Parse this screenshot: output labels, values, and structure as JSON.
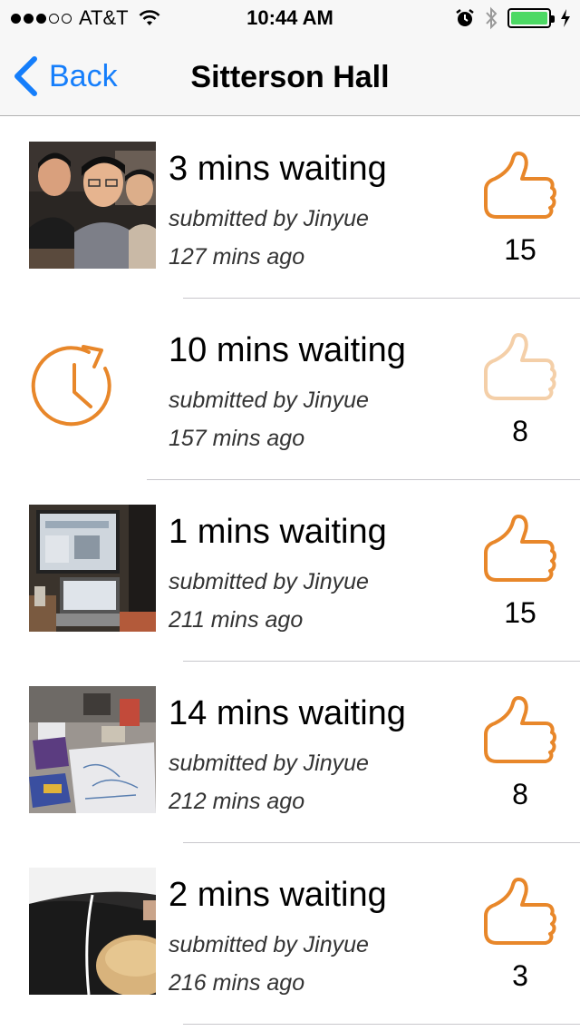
{
  "status_bar": {
    "carrier": "AT&T",
    "time": "10:44 AM",
    "signal_bars_filled": 3,
    "signal_bars_total": 5,
    "battery_color": "#4cd964",
    "icons": [
      "wifi-icon",
      "alarm-icon",
      "bluetooth-icon",
      "battery-icon",
      "charging-icon"
    ]
  },
  "nav": {
    "back_label": "Back",
    "title": "Sitterson Hall",
    "accent_color": "#157efb"
  },
  "accent_color": "#e8872a",
  "items": [
    {
      "title": "3 mins waiting",
      "submitted": "submitted by Jinyue",
      "time_ago": "127 mins ago",
      "likes": "15",
      "image": "group-selfie-photo",
      "liked": true
    },
    {
      "title": "10 mins waiting",
      "submitted": "submitted by Jinyue",
      "time_ago": "157 mins ago",
      "likes": "8",
      "image": "clock-icon",
      "liked": false
    },
    {
      "title": "1 mins waiting",
      "submitted": "submitted by Jinyue",
      "time_ago": "211 mins ago",
      "likes": "15",
      "image": "computer-desk-photo",
      "liked": true
    },
    {
      "title": "14 mins waiting",
      "submitted": "submitted by Jinyue",
      "time_ago": "212 mins ago",
      "likes": "8",
      "image": "cluttered-table-photo",
      "liked": true
    },
    {
      "title": "2 mins waiting",
      "submitted": "submitted by Jinyue",
      "time_ago": "216 mins ago",
      "likes": "3",
      "image": "dark-room-photo",
      "liked": true
    }
  ]
}
